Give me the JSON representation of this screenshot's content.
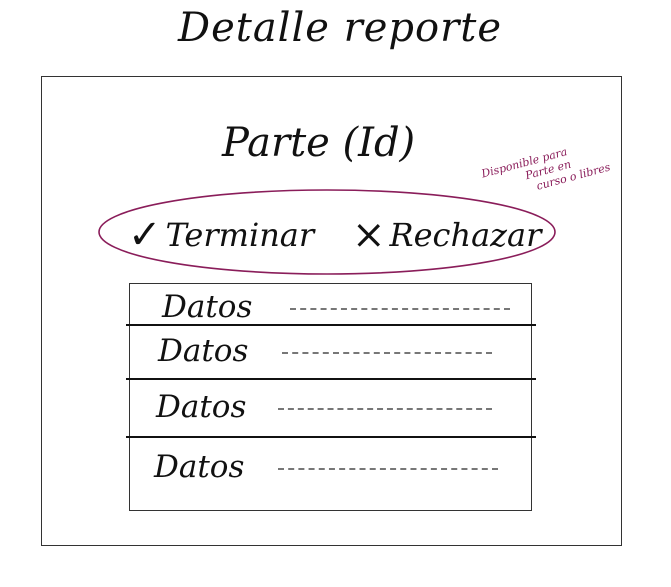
{
  "header": {
    "title": "Detalle reporte"
  },
  "detail": {
    "part_title": "Parte (Id)",
    "note": {
      "line1": "Disponible para",
      "line2": "Parte en",
      "line3": "curso o libres"
    },
    "actions": {
      "accept_icon": "✓",
      "accept_label": "Terminar",
      "reject_icon": "×",
      "reject_label": "Rechazar"
    },
    "rows": [
      {
        "label": "Datos"
      },
      {
        "label": "Datos"
      },
      {
        "label": "Datos"
      },
      {
        "label": "Datos"
      }
    ]
  },
  "colors": {
    "ink": "#111111",
    "annotation": "#8a1d5a"
  }
}
